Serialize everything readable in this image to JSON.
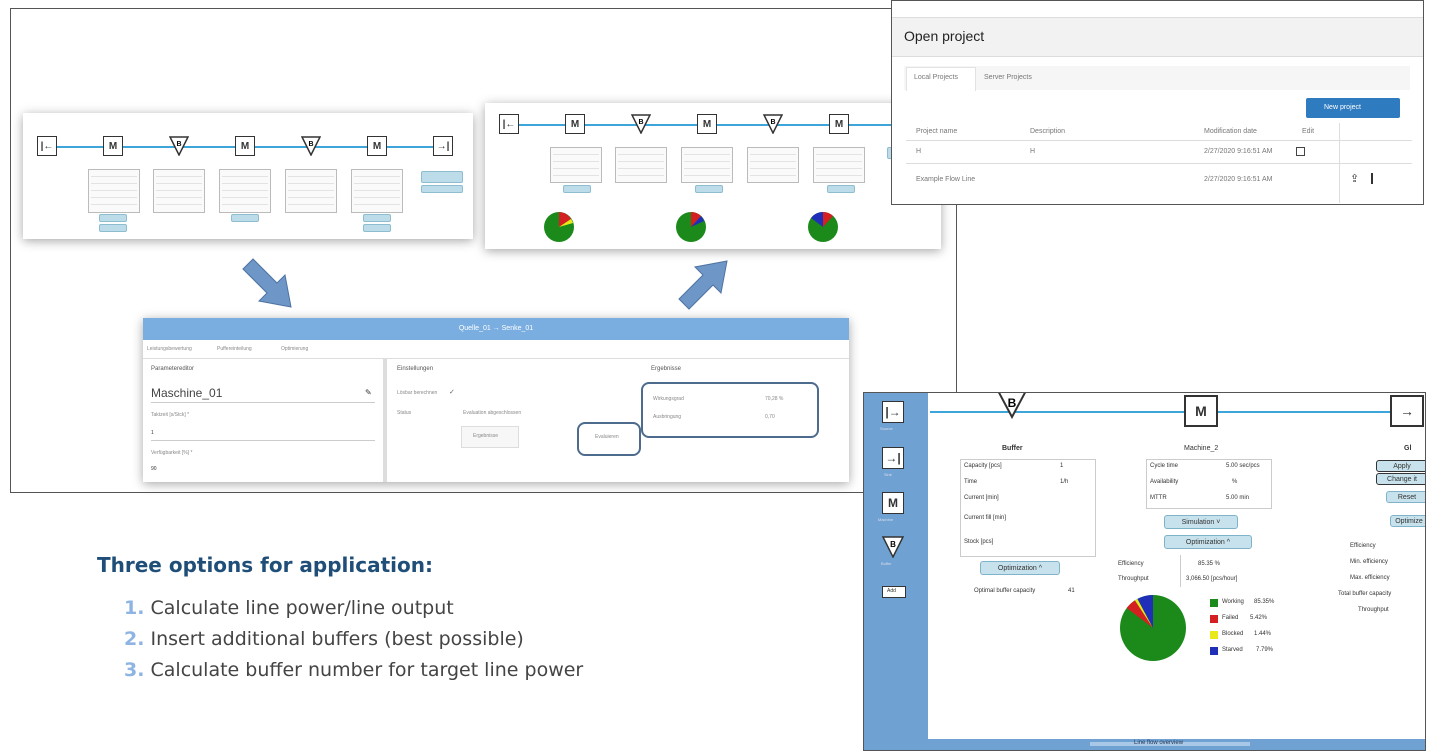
{
  "heading": "Three options for application:",
  "options": [
    {
      "num": "1.",
      "text": "Calculate line power/line output"
    },
    {
      "num": "2.",
      "text": "Insert additional buffers (best possible)"
    },
    {
      "num": "3.",
      "text": "Calculate buffer number for target line power"
    }
  ],
  "dialog": {
    "title": "Quelle_01 → Senke_01",
    "tabs": [
      "Leistungsbewertung",
      "Puffereinteilung",
      "Optimierung"
    ],
    "param_editor": "Parametereditor",
    "machine_name": "Maschine_01",
    "field1_label": "Taktzeit [s/Stck] *",
    "field1_value": "1",
    "field2_label": "Verfügbarkeit [%] *",
    "field2_value": "90",
    "settings": "Einstellungen",
    "checkbox_label": "Lösbar berechnen",
    "status_label": "Status",
    "status_value": "Evaluation abgeschlossen",
    "btn_results": "Ergebnisse",
    "btn_evaluate": "Evaluieren",
    "results": "Ergebnisse",
    "wirkungsgrad_label": "Wirkungsgrad",
    "wirkungsgrad_value": "70,28 %",
    "ausbringung_label": "Ausbringung",
    "ausbringung_value": "0,70"
  },
  "open_project": {
    "title": "Open project",
    "tab_local": "Local Projects",
    "tab_server": "Server Projects",
    "new_button": "New project",
    "columns": [
      "Project name",
      "Description",
      "Modification date",
      "Edit"
    ],
    "rows": [
      {
        "name": "H",
        "description": "H",
        "date": "2/27/2020 9:16:51 AM"
      },
      {
        "name": "Example Flow Line",
        "description": "",
        "date": "2/27/2020 9:16:51 AM"
      }
    ]
  },
  "editor": {
    "tools": [
      {
        "label": "Source",
        "glyph": "|→"
      },
      {
        "label": "Sink",
        "glyph": "→|"
      },
      {
        "label": "Machine",
        "glyph": "M"
      },
      {
        "label": "Buffer",
        "glyph": "B"
      }
    ],
    "tool_add": "Add",
    "buffer_title": "Buffer",
    "buffer_rows": [
      "Capacity [pcs]",
      "Time",
      "Current [min]",
      "Current fill [min]",
      "Stock [pcs]"
    ],
    "buffer_values": [
      "1",
      "1/h",
      "",
      "",
      ""
    ],
    "buffer_button": "Optimization ^",
    "buffer_optimal_label": "Optimal buffer capacity",
    "buffer_optimal_value": "41",
    "machine_title": "Machine_2",
    "machine_rows": [
      "Cycle time",
      "Availability",
      "MTTR"
    ],
    "machine_values": [
      "5.00 sec/pcs",
      "%",
      "5.00 min"
    ],
    "machine_btn_1": "Simulation ˅",
    "machine_btn_2": "Optimization ^",
    "efficiency_label": "Efficiency",
    "efficiency_value": "85.35 %",
    "throughput_label": "Throughput",
    "throughput_value": "3,066.50 [pcs/hour]",
    "legend": [
      {
        "label": "Working",
        "value": "85.35%",
        "color": "#1b8a1b"
      },
      {
        "label": "Failed",
        "value": "5.42%",
        "color": "#d42020"
      },
      {
        "label": "Blocked",
        "value": "1.44%",
        "color": "#e8e81a"
      },
      {
        "label": "Starved",
        "value": "7.79%",
        "color": "#1f2fb8"
      }
    ],
    "pie": [
      85.35,
      5.42,
      1.44,
      7.79
    ],
    "right_title": "Gl",
    "right_buttons": [
      "Apply",
      "Change it",
      "Reset",
      "Optimize"
    ],
    "right_metrics": [
      "Efficiency",
      "Min. efficiency",
      "Max. efficiency",
      "Total buffer capacity",
      "Throughput"
    ],
    "bottom_label": "Line flow overview",
    "colors": {
      "sidebar": "#6fa2d3",
      "line": "#3da5d9",
      "accent": "#1f4e79"
    }
  }
}
